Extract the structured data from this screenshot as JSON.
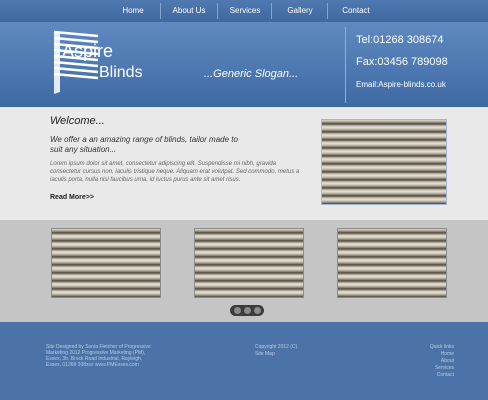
{
  "nav": {
    "items": [
      "Home",
      "About Us",
      "Services",
      "Gallery",
      "Contact"
    ]
  },
  "header": {
    "logo_line1": "Aspire",
    "logo_line2": "Blinds",
    "slogan": "...Generic Slogan...",
    "tel": "Tel:01268 308674",
    "fax": "Fax:03456 789098",
    "email": "Email:Aspire-blinds.co.uk"
  },
  "welcome": {
    "title": "Welcome...",
    "intro": "We offer a an amazing range of blinds, tailor made to suit any situation...",
    "lorem": "Lorem ipsum dolor sit amet, consectetur adipiscing elit. Suspendisse mi nibh, gravida consectetur cursus non, iaculis tristique neque. Aliquam erat volutpat. Sed commodo, metus a iaculis porta, nulla nisl faucibus urna, id luctus purus ante sit amet risus.",
    "read_more": "Read More>>"
  },
  "footer": {
    "credits": "Site Designed by Sonia Fletcher of Progressive Marketing 2012 Progressive Marketing (PM), Essex, 3b, Brock Road Industrial, Rayleigh, Essex, 01268 308xxx www.PMEssex.com",
    "copyright": "Copyright 2012 (C)",
    "sitemap": "Site Map",
    "quick_links_title": "Quick links",
    "quick_links": [
      "Home",
      "About",
      "Services",
      "Contact"
    ]
  },
  "colors": {
    "brand_blue": "#4b73a8",
    "light_band": "#e9e9e9",
    "gallery_band": "#c5c5c5"
  }
}
